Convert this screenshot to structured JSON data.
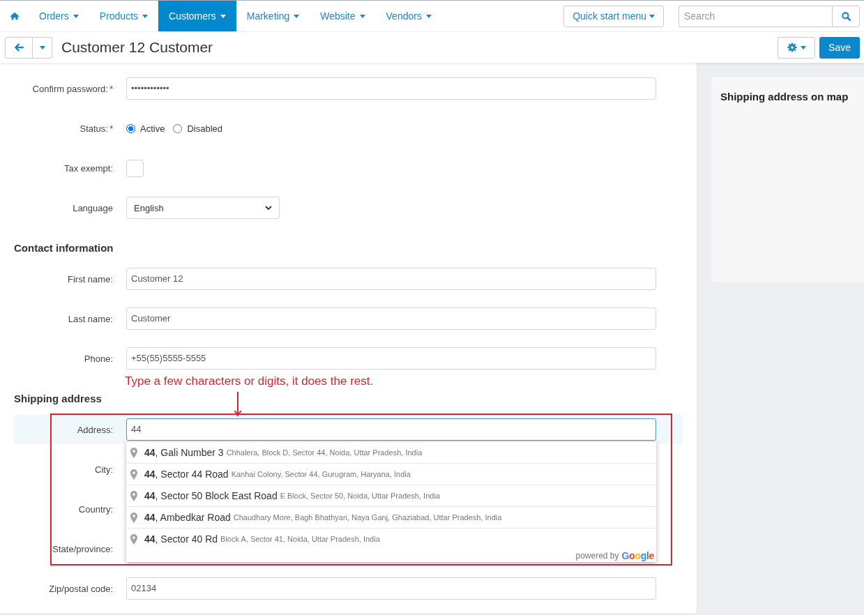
{
  "nav": {
    "items": [
      {
        "label": "Orders",
        "selected": false
      },
      {
        "label": "Products",
        "selected": false
      },
      {
        "label": "Customers",
        "selected": true
      },
      {
        "label": "Marketing",
        "selected": false
      },
      {
        "label": "Website",
        "selected": false
      },
      {
        "label": "Vendors",
        "selected": false
      }
    ],
    "quick_start": {
      "label": "Quick start menu"
    },
    "search": {
      "placeholder": "Search"
    }
  },
  "toolbar": {
    "title": "Customer 12 Customer",
    "save": "Save"
  },
  "sections": [
    {
      "fields": [
        {
          "kind": "password",
          "label": "Confirm password:",
          "required_mark": "*",
          "value": "••••••••••••"
        },
        {
          "kind": "radio",
          "label": "Status:",
          "required_mark": "*",
          "options": [
            {
              "label": "Active",
              "selected": true
            },
            {
              "label": "Disabled",
              "selected": false
            }
          ]
        },
        {
          "kind": "checkbox",
          "label": "Tax exempt:",
          "checked": false
        },
        {
          "kind": "select",
          "label": "Language",
          "value": "English"
        }
      ]
    },
    {
      "heading": "Contact information",
      "fields": [
        {
          "kind": "text",
          "label": "First name:",
          "value": "Customer 12"
        },
        {
          "kind": "text",
          "label": "Last name:",
          "value": "Customer"
        },
        {
          "kind": "text",
          "label": "Phone:",
          "value": "+55(55)5555-5555"
        }
      ]
    },
    {
      "heading": "Shipping address",
      "fields": [
        {
          "kind": "autocomplete",
          "label": "Address:",
          "value": "44",
          "focused": true,
          "highlighted": true,
          "suggestions": [
            {
              "main": "**44**, Gali Number 3",
              "secondary": "Chhalera, Block D, Sector 44, Noida, Uttar Pradesh, India"
            },
            {
              "main": "**44**, Sector 44 Road",
              "secondary": "Kanhai Colony, Sector 44, Gurugram, Haryana, India"
            },
            {
              "main": "**44**, Sector 50 Block East Road",
              "secondary": "E Block, Sector 50, Noida, Uttar Pradesh, India"
            },
            {
              "main": "**44**, Ambedkar Road",
              "secondary": "Chaudhary More, Bagh Bhathyari, Naya Ganj, Ghaziabad, Uttar Pradesh, India"
            },
            {
              "main": "**44**, Sector 40 Rd",
              "secondary": "Block A, Sector 41, Noida, Uttar Pradesh, India"
            }
          ],
          "attribution": {
            "text": "powered by",
            "logo": "Google"
          }
        },
        {
          "kind": "obscured",
          "label": "City:"
        },
        {
          "kind": "obscured",
          "label": "Country:"
        },
        {
          "kind": "obscured",
          "label": "State/province:"
        },
        {
          "kind": "text",
          "label": "Zip/postal code:",
          "value": "02134"
        }
      ]
    }
  ],
  "annotation": {
    "text": "Type a few characters or digits, it does the rest."
  },
  "map_panel": {
    "title": "Shipping address on map"
  }
}
